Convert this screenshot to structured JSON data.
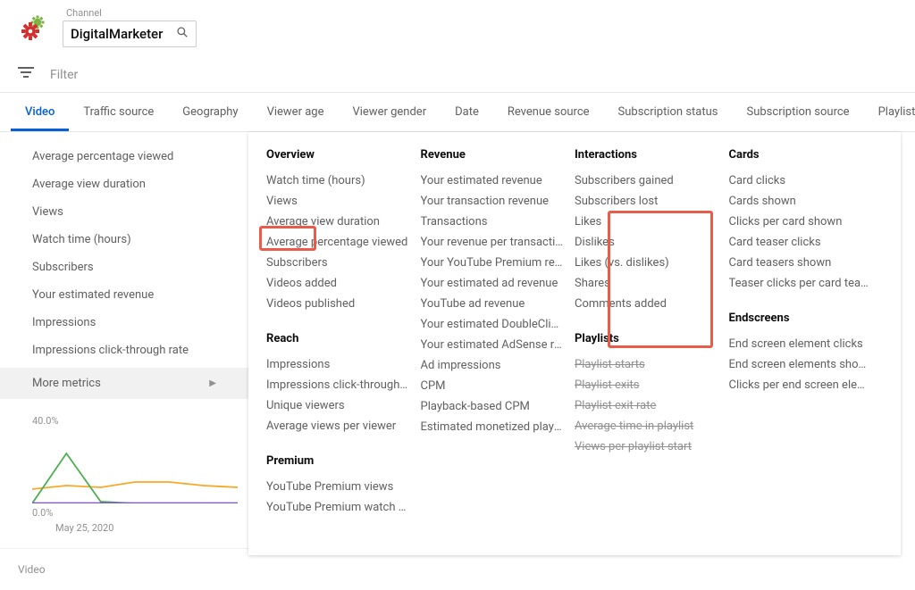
{
  "header": {
    "channel_label": "Channel",
    "channel_name": "DigitalMarketer"
  },
  "filter": {
    "placeholder": "Filter"
  },
  "tabs": [
    {
      "label": "Video",
      "active": true
    },
    {
      "label": "Traffic source",
      "active": false
    },
    {
      "label": "Geography",
      "active": false
    },
    {
      "label": "Viewer age",
      "active": false
    },
    {
      "label": "Viewer gender",
      "active": false
    },
    {
      "label": "Date",
      "active": false
    },
    {
      "label": "Revenue source",
      "active": false
    },
    {
      "label": "Subscription status",
      "active": false
    },
    {
      "label": "Subscription source",
      "active": false
    },
    {
      "label": "Playlist",
      "active": false
    }
  ],
  "sidebar": {
    "items": [
      "Average percentage viewed",
      "Average view duration",
      "Views",
      "Watch time (hours)",
      "Subscribers",
      "Your estimated revenue",
      "Impressions",
      "Impressions click-through rate"
    ],
    "more_label": "More metrics"
  },
  "chart_data": {
    "type": "line",
    "ylabel_top": "40.0%",
    "ylabel_bottom": "0.0%",
    "xlabel": "May 25, 2020",
    "ylim": [
      0,
      40
    ],
    "x": [
      0,
      1,
      2,
      3,
      4,
      5,
      6
    ],
    "series": [
      {
        "name": "orange",
        "color": "#f9a825",
        "values": [
          8,
          10,
          9,
          12,
          12,
          10,
          9
        ]
      },
      {
        "name": "green",
        "color": "#4caf50",
        "values": [
          0,
          28,
          1,
          0,
          0,
          0,
          0
        ]
      },
      {
        "name": "purple",
        "color": "#7e57c2",
        "values": [
          0.2,
          0.2,
          0.2,
          0.2,
          0.2,
          0.2,
          0.2
        ]
      }
    ]
  },
  "video_footer": "Video",
  "metrics": {
    "col1": {
      "groups": [
        {
          "head": "Overview",
          "items": [
            "Watch time (hours)",
            "Views",
            "Average view duration",
            "Average percentage viewed",
            "Subscribers",
            "Videos added",
            "Videos published"
          ]
        },
        {
          "head": "Reach",
          "items": [
            "Impressions",
            "Impressions click-through rate",
            "Unique viewers",
            "Average views per viewer"
          ]
        },
        {
          "head": "Premium",
          "items": [
            "YouTube Premium views",
            "YouTube Premium watch time (hours)"
          ]
        }
      ]
    },
    "col2": {
      "groups": [
        {
          "head": "Revenue",
          "items": [
            "Your estimated revenue",
            "Your transaction revenue",
            "Transactions",
            "Your revenue per transaction",
            "Your YouTube Premium revenue",
            "Your estimated ad revenue",
            "YouTube ad revenue",
            "Your estimated DoubleClick revenue",
            "Your estimated AdSense revenue",
            "Ad impressions",
            "CPM",
            "Playback-based CPM",
            "Estimated monetized playbacks"
          ]
        }
      ]
    },
    "col3": {
      "groups": [
        {
          "head": "Interactions",
          "items": [
            "Subscribers gained",
            "Subscribers lost",
            "Likes",
            "Dislikes",
            "Likes (vs. dislikes)",
            "Shares",
            "Comments added"
          ]
        },
        {
          "head": "Playlists",
          "strike": true,
          "items": [
            "Playlist starts",
            "Playlist exits",
            "Playlist exit rate",
            "Average time in playlist",
            "Views per playlist start"
          ]
        }
      ]
    },
    "col4": {
      "groups": [
        {
          "head": "Cards",
          "items": [
            "Card clicks",
            "Cards shown",
            "Clicks per card shown",
            "Card teaser clicks",
            "Card teasers shown",
            "Teaser clicks per card teaser shown"
          ]
        },
        {
          "head": "Endscreens",
          "items": [
            "End screen element clicks",
            "End screen elements shown",
            "Clicks per end screen element shown"
          ]
        }
      ]
    }
  }
}
